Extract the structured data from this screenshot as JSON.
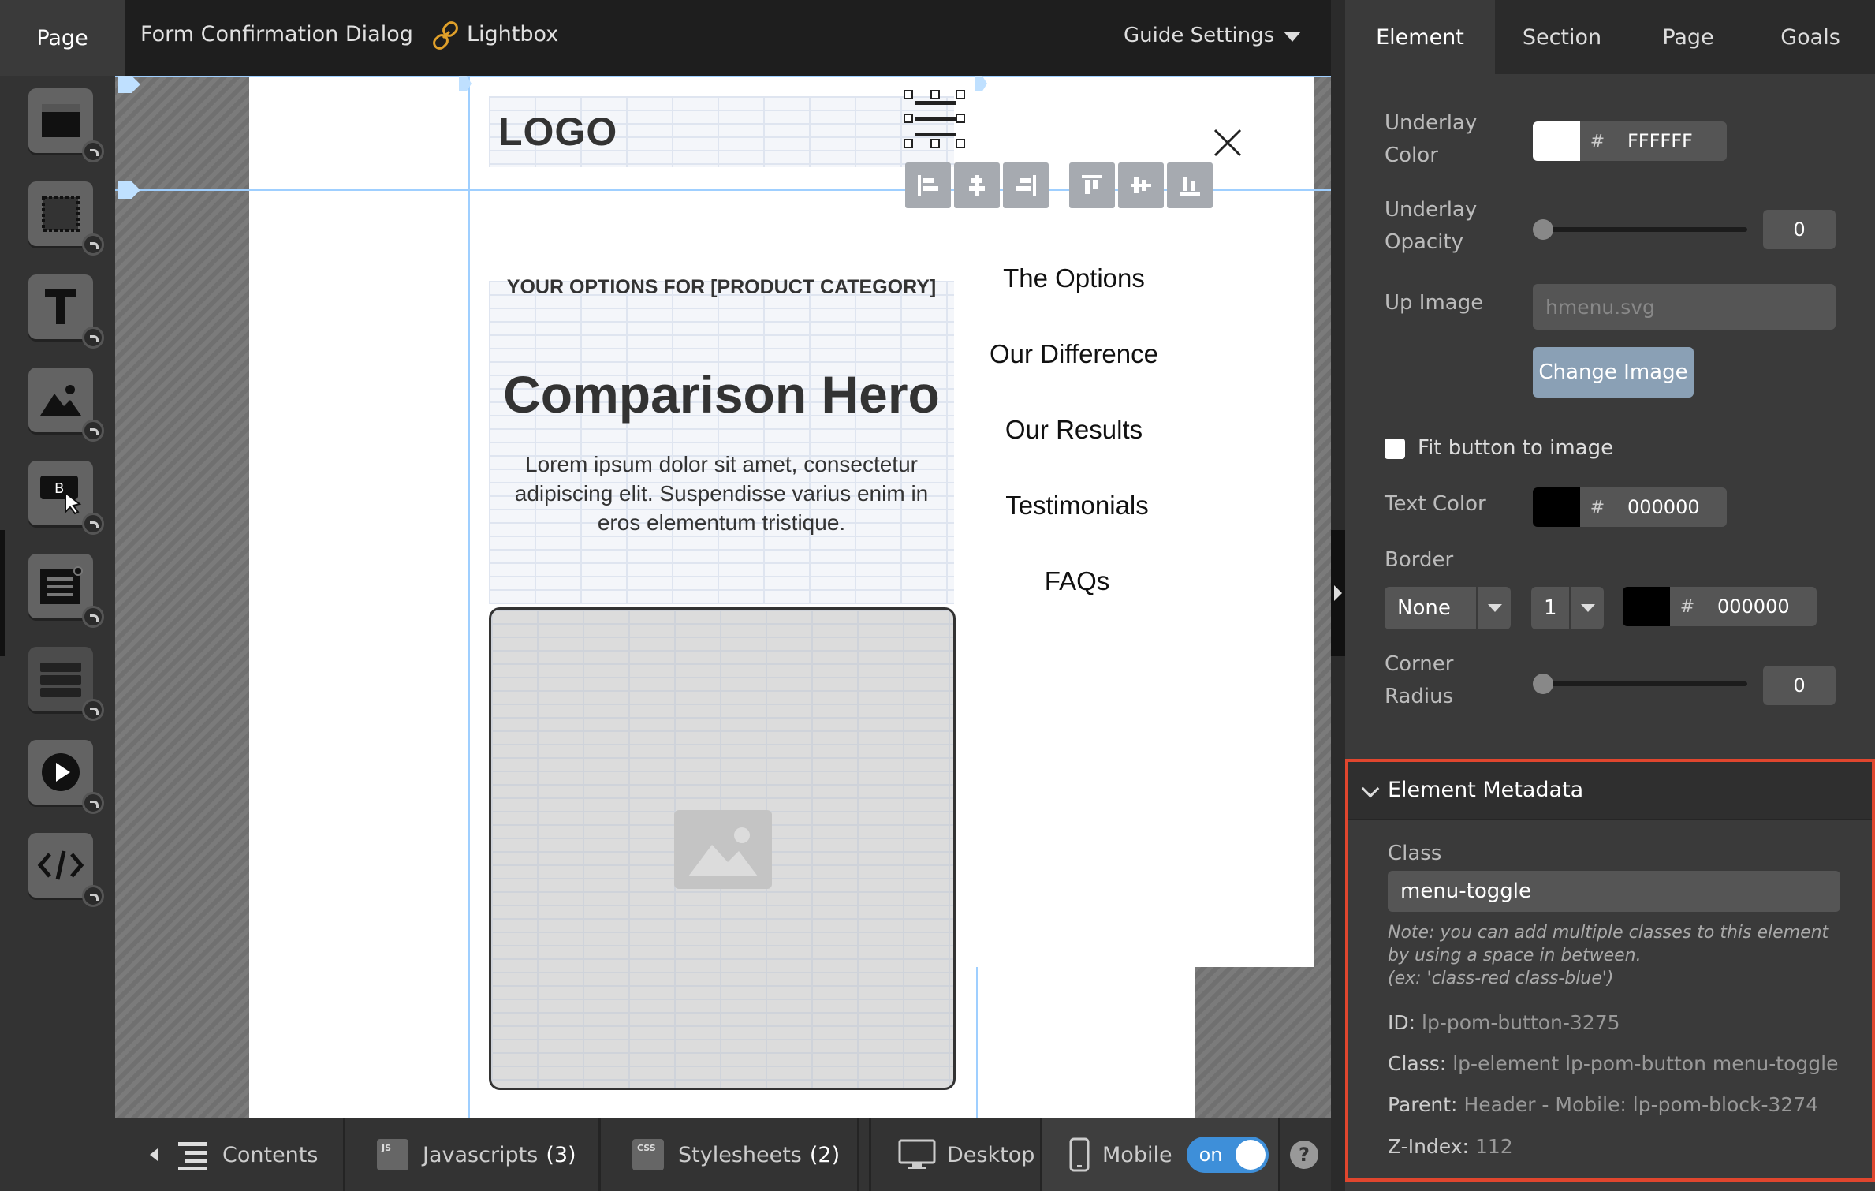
{
  "topbar": {
    "page_tab": "Page",
    "breadcrumb_1": "Form Confirmation Dialog",
    "breadcrumb_2": "Lightbox",
    "guide_settings": "Guide Settings",
    "icons": [
      "link-icon",
      "caret-down-icon"
    ]
  },
  "left_tools": {
    "icons": [
      "section-tool-icon",
      "box-tool-icon",
      "text-tool-icon",
      "image-tool-icon",
      "button-tool-icon",
      "form-tool-icon",
      "social-tool-icon",
      "video-tool-icon",
      "custom-html-tool-icon"
    ]
  },
  "canvas": {
    "logo": "LOGO",
    "eyebrow": "YOUR OPTIONS FOR [PRODUCT CATEGORY]",
    "hero_title": "Comparison Hero",
    "hero_body": "Lorem ipsum dolor sit amet, consectetur adipiscing elit. Suspendisse varius enim in eros elementum tristique.",
    "nav": [
      "The Options",
      "Our Difference",
      "Our Results",
      "Testimonials",
      "FAQs"
    ],
    "align_tools": [
      "align-left-icon",
      "align-center-icon",
      "align-right-icon",
      "align-top-icon",
      "align-middle-icon",
      "align-bottom-icon"
    ],
    "accent_color": "#9fcfff"
  },
  "bottombar": {
    "contents": "Contents",
    "javascripts": "Javascripts",
    "javascripts_count": "(3)",
    "js_badge": "JS",
    "stylesheets": "Stylesheets",
    "stylesheets_count": "(2)",
    "css_badge": "CSS",
    "desktop": "Desktop",
    "mobile": "Mobile",
    "mobile_toggle": "on",
    "help": "?",
    "toggle_color": "#3e8fd9"
  },
  "rightpanel": {
    "tabs": [
      "Element",
      "Section",
      "Page",
      "Goals"
    ],
    "underlay_color_label": "Underlay Color",
    "underlay_color_hex": "FFFFFF",
    "underlay_opacity_label": "Underlay Opacity",
    "underlay_opacity_value": "0",
    "up_image_label": "Up Image",
    "up_image_value": "hmenu.svg",
    "change_image": "Change Image",
    "fit_button_label": "Fit button to image",
    "text_color_label": "Text Color",
    "text_color_hex": "000000",
    "border_label": "Border",
    "border_style": "None",
    "border_width": "1",
    "border_color_hex": "000000",
    "corner_radius_label": "Corner Radius",
    "corner_radius_value": "0",
    "hash": "#",
    "metadata": {
      "title": "Element Metadata",
      "class_label": "Class",
      "class_value": "menu-toggle",
      "note": "Note: you can add multiple classes to this element by using a space in between.\n(ex: 'class-red class-blue')",
      "id_label": "ID:",
      "id_value": "lp-pom-button-3275",
      "class_row_label": "Class:",
      "class_row_value": "lp-element lp-pom-button menu-toggle",
      "parent_label": "Parent:",
      "parent_value": "Header - Mobile: lp-pom-block-3274",
      "zindex_label": "Z-Index:",
      "zindex_value": "112",
      "highlight_color": "#e0462e"
    }
  }
}
